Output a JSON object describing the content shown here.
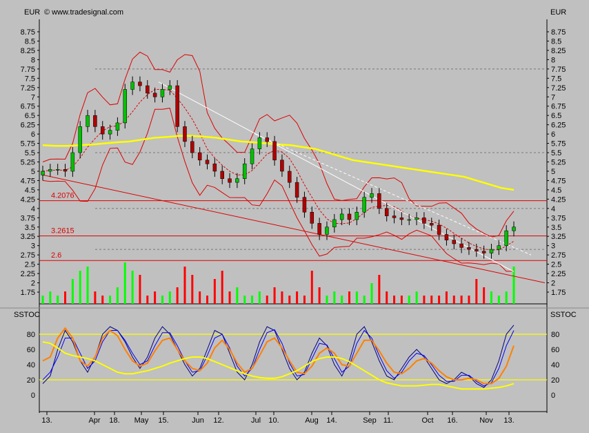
{
  "header": {
    "currency_left": "EUR",
    "currency_right": "EUR",
    "copyright": "© www.tradesignal.com"
  },
  "colors": {
    "background": "#c0c0c0",
    "up_candle": "#00c000",
    "down_candle": "#b00000",
    "bollinger": "#dd0000",
    "moving_average": "#ffff00",
    "volume_up": "#00ff00",
    "volume_down": "#ff0000",
    "sstoc_fast": "#000080",
    "sstoc_blue": "#0000ff",
    "sstoc_orange": "#ff8000",
    "sstoc_yellow": "#ffff00",
    "support_line": "#dd0000",
    "trend_line": "#ffffff"
  },
  "chart_data": [
    {
      "type": "candlestick",
      "name": "price",
      "y_unit": "EUR",
      "y_ticks": [
        "8.75",
        "8.5",
        "8.25",
        "8",
        "7.75",
        "7.5",
        "7.25",
        "7",
        "6.75",
        "6.5",
        "6.25",
        "6",
        "5.75",
        "5.5",
        "5.25",
        "5",
        "4.75",
        "4.5",
        "4.25",
        "4",
        "3.75",
        "3.5",
        "3.25",
        "3",
        "2.75",
        "2.5",
        "2.25",
        "2",
        "1.75"
      ],
      "ylim": [
        1.5,
        9.0
      ],
      "x_ticks": [
        "13.",
        "Apr",
        "18.",
        "May",
        "15.",
        "Jun",
        "12.",
        "Jul",
        "10.",
        "Aug",
        "14.",
        "Sep",
        "11.",
        "Oct",
        "16.",
        "Nov",
        "13."
      ],
      "horizontal_lines": [
        {
          "label": "4.2076",
          "value": 4.2076
        },
        {
          "label": "3.2615",
          "value": 3.2615
        },
        {
          "label": "2.6",
          "value": 2.6
        }
      ],
      "dashed_levels": [
        7.75,
        5.5,
        4.0,
        2.9
      ],
      "moving_average": [
        5.7,
        5.68,
        5.68,
        5.7,
        5.72,
        5.75,
        5.78,
        5.8,
        5.85,
        5.9,
        5.92,
        5.95,
        5.95,
        5.93,
        5.9,
        5.85,
        5.8,
        5.78,
        5.75,
        5.72,
        5.7,
        5.65,
        5.6,
        5.5,
        5.4,
        5.3,
        5.25,
        5.2,
        5.15,
        5.1,
        5.05,
        5.0,
        4.95,
        4.9,
        4.85,
        4.75,
        4.65,
        4.55,
        4.5
      ],
      "close_prices": [
        5.0,
        5.05,
        5.05,
        5.0,
        5.5,
        6.2,
        6.5,
        6.2,
        6.0,
        6.1,
        6.3,
        7.2,
        7.4,
        7.3,
        7.1,
        7.0,
        7.2,
        7.3,
        6.2,
        5.8,
        5.5,
        5.3,
        5.2,
        5.0,
        4.8,
        4.7,
        4.8,
        5.2,
        5.6,
        5.9,
        5.8,
        5.3,
        5.0,
        4.7,
        4.3,
        3.9,
        3.6,
        3.3,
        3.5,
        3.7,
        3.85,
        3.7,
        3.9,
        4.3,
        4.4,
        4.0,
        3.8,
        3.75,
        3.7,
        3.7,
        3.75,
        3.6,
        3.55,
        3.3,
        3.15,
        3.05,
        2.95,
        2.9,
        2.85,
        2.8,
        2.9,
        3.0,
        3.4,
        3.5
      ]
    },
    {
      "type": "bar",
      "name": "volume",
      "values": [
        2,
        3,
        2,
        3,
        6,
        8,
        9,
        3,
        2,
        2,
        4,
        10,
        8,
        7,
        2,
        3,
        2,
        3,
        4,
        9,
        7,
        3,
        2,
        6,
        8,
        3,
        4,
        2,
        2,
        3,
        2,
        4,
        3,
        2,
        3,
        2,
        8,
        4,
        2,
        3,
        2,
        3,
        3,
        2,
        5,
        7,
        3,
        2,
        2,
        2,
        3,
        2,
        2,
        2,
        3,
        2,
        2,
        2,
        6,
        4,
        3,
        2,
        3,
        9
      ]
    },
    {
      "type": "line",
      "name": "SSTOC",
      "y_ticks": [
        "80",
        "60",
        "40",
        "20",
        "0"
      ],
      "ylim": [
        -5,
        100
      ],
      "bands": [
        80,
        20
      ],
      "series": [
        {
          "values": [
            15,
            25,
            60,
            85,
            70,
            45,
            30,
            50,
            80,
            90,
            85,
            70,
            50,
            35,
            50,
            75,
            90,
            80,
            60,
            40,
            25,
            35,
            60,
            85,
            80,
            55,
            30,
            20,
            40,
            70,
            90,
            85,
            60,
            35,
            20,
            30,
            55,
            75,
            65,
            40,
            25,
            45,
            80,
            90,
            70,
            45,
            25,
            20,
            35,
            50,
            60,
            50,
            35,
            20,
            15,
            20,
            30,
            25,
            15,
            10,
            20,
            45,
            80,
            92
          ]
        },
        {
          "values": [
            20,
            30,
            50,
            75,
            75,
            55,
            35,
            45,
            70,
            85,
            85,
            72,
            55,
            40,
            45,
            65,
            82,
            82,
            65,
            45,
            30,
            32,
            52,
            75,
            80,
            62,
            38,
            25,
            35,
            60,
            82,
            86,
            68,
            42,
            25,
            27,
            48,
            68,
            66,
            48,
            30,
            38,
            68,
            85,
            75,
            52,
            32,
            22,
            30,
            45,
            55,
            52,
            40,
            26,
            18,
            18,
            26,
            26,
            18,
            12,
            16,
            35,
            65,
            85
          ]
        },
        {
          "values": [
            45,
            50,
            75,
            88,
            75,
            45,
            38,
            50,
            75,
            85,
            78,
            60,
            45,
            38,
            42,
            58,
            72,
            75,
            60,
            45,
            35,
            32,
            42,
            62,
            72,
            60,
            42,
            30,
            35,
            52,
            70,
            75,
            62,
            45,
            30,
            28,
            38,
            55,
            62,
            55,
            40,
            38,
            55,
            72,
            72,
            58,
            42,
            30,
            28,
            35,
            45,
            48,
            42,
            32,
            24,
            20,
            20,
            22,
            20,
            15,
            15,
            22,
            38,
            65
          ]
        },
        {
          "values": [
            70,
            68,
            62,
            55,
            52,
            50,
            48,
            45,
            40,
            35,
            30,
            28,
            28,
            30,
            32,
            35,
            38,
            42,
            45,
            48,
            50,
            50,
            48,
            44,
            40,
            36,
            32,
            28,
            25,
            23,
            22,
            22,
            24,
            28,
            32,
            38,
            44,
            48,
            50,
            50,
            48,
            44,
            38,
            32,
            26,
            20,
            16,
            14,
            12,
            12,
            12,
            13,
            14,
            14,
            12,
            10,
            8,
            8,
            8,
            8,
            9,
            10,
            12,
            15
          ]
        }
      ]
    }
  ]
}
